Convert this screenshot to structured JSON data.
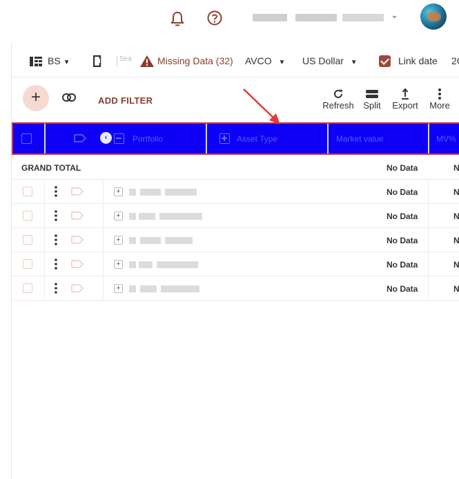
{
  "toolbar": {
    "view_label": "BS",
    "search_placeholder": "Sea",
    "missing_data": "Missing Data (32)",
    "cost_method": "AVCO",
    "currency": "US Dollar",
    "link_date": "Link date",
    "overflow_text": "2C"
  },
  "actions": {
    "add_filter": "ADD FILTER",
    "refresh": "Refresh",
    "split": "Split",
    "export": "Export",
    "more": "More"
  },
  "table": {
    "columns": [
      "Portfolio",
      "Asset Type",
      "Market value",
      "MV%"
    ],
    "grand_total_label": "GRAND TOTAL",
    "no_data": "No Data",
    "mv_truncated": "N",
    "row_count": 5
  },
  "colors": {
    "accent": "#8b3d2c",
    "selected_header": "#0d00f5",
    "highlight_border": "#d93042",
    "arrow": "#e03a3a"
  }
}
